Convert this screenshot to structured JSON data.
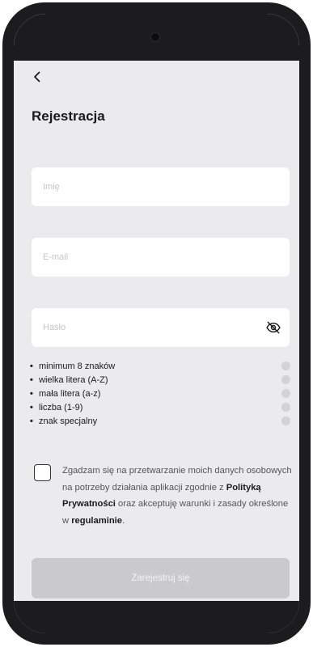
{
  "header": {
    "title": "Rejestracja"
  },
  "form": {
    "name_placeholder": "Imię",
    "email_placeholder": "E-mail",
    "password_placeholder": "Hasło"
  },
  "requirements": [
    "minimum 8 znaków",
    "wielka litera (A-Z)",
    "mała litera (a-z)",
    "liczba (1-9)",
    "znak specjalny"
  ],
  "consent": {
    "text_1": "Zgadzam się na przetwarzanie moich danych osobowych na potrzeby działania aplikacji zgodnie z ",
    "privacy_link": "Polityką Prywatności",
    "text_2": " oraz akceptuję warunki i zasady określone w ",
    "terms_link": "regulaminie",
    "text_3": "."
  },
  "submit_label": "Zarejestruj się",
  "icons": {
    "back": "chevron-left-icon",
    "password_toggle": "eye-off-icon"
  },
  "colors": {
    "background": "#ebebed",
    "input_bg": "#ffffff",
    "button_disabled": "#cacacd",
    "bezel": "#1c1c1e"
  }
}
